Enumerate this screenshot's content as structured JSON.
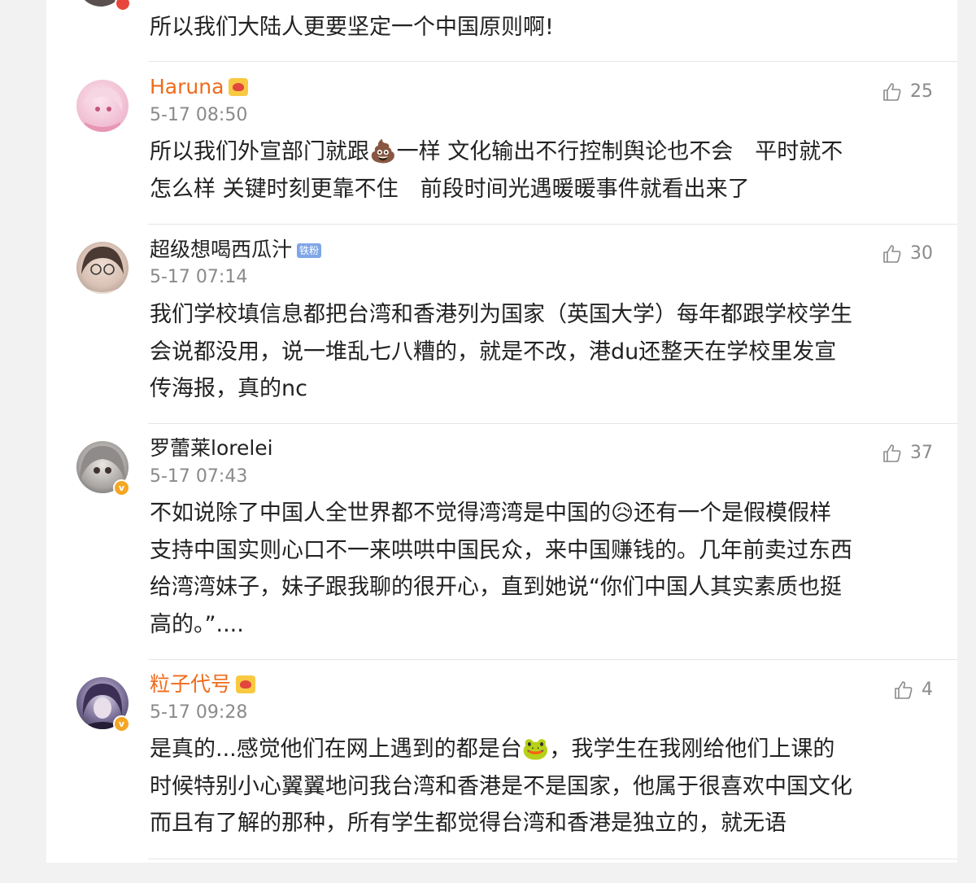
{
  "top_comment": {
    "text": "所以我们大陆人更要坚定一个中国原则啊!"
  },
  "comments": [
    {
      "name": "Haruna",
      "time": "5-17 08:50",
      "likes": "25",
      "lines": [
        "所以我们外宣部门就跟💩一样 文化输出不行控制舆论也不会　平时就不",
        "怎么样 关键时刻更靠不住　前段时间光遇暖暖事件就看出来了"
      ]
    },
    {
      "name": "超级想喝西瓜汁",
      "badge": "铁粉",
      "time": "5-17 07:14",
      "likes": "30",
      "lines": [
        "我们学校填信息都把台湾和香港列为国家（英国大学）每年都跟学校学生",
        "会说都没用，说一堆乱七八糟的，就是不改，港du还整天在学校里发宣",
        "传海报，真的nc"
      ]
    },
    {
      "name": "罗蕾莱lorelei",
      "time": "5-17 07:43",
      "likes": "37",
      "lines": [
        "不如说除了中国人全世界都不觉得湾湾是中国的😥还有一个是假模假样",
        "支持中国实则心口不一来哄哄中国民众，来中国赚钱的。几年前卖过东西",
        "给湾湾妹子，妹子跟我聊的很开心，直到她说“你们中国人其实素质也挺",
        "高的。”...."
      ]
    },
    {
      "name": "粒子代号",
      "time": "5-17 09:28",
      "likes": "4",
      "lines": [
        "是真的...感觉他们在网上遇到的都是台🐸，我学生在我刚给他们上课的",
        "时候特别小心翼翼地问我台湾和香港是不是国家，他属于很喜欢中国文化",
        "而且有了解的那种，所有学生都觉得台湾和香港是独立的，就无语"
      ]
    }
  ],
  "colors": {
    "vip_name": "#f06b1b",
    "normal_name": "#222222",
    "meta": "#8a8a8a"
  }
}
